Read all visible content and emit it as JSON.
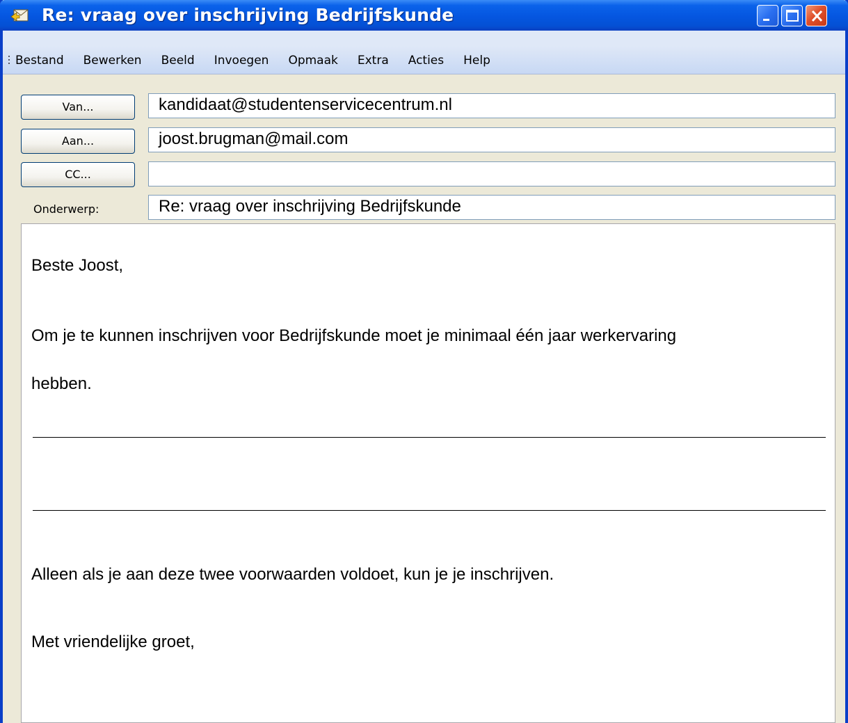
{
  "window": {
    "title": "Re: vraag over inschrijving Bedrijfskunde"
  },
  "menu": [
    "Bestand",
    "Bewerken",
    "Beeld",
    "Invoegen",
    "Opmaak",
    "Extra",
    "Acties",
    "Help"
  ],
  "headers": {
    "from_button": "Van...",
    "from_value": "kandidaat@studentenservicecentrum.nl",
    "to_button": "Aan...",
    "to_value": "joost.brugman@mail.com",
    "cc_button": "CC...",
    "cc_value": "",
    "subject_label": "Onderwerp:",
    "subject_value": "Re: vraag over inschrijving Bedrijfskunde"
  },
  "body": {
    "greeting": "Beste Joost,",
    "line1": "Om je te kunnen inschrijven voor Bedrijfskunde moet je minimaal één jaar werkervaring",
    "line2": "hebben.",
    "line3": "Alleen als je aan deze twee voorwaarden voldoet, kun je je inschrijven.",
    "closing": "Met vriendelijke groet,"
  }
}
